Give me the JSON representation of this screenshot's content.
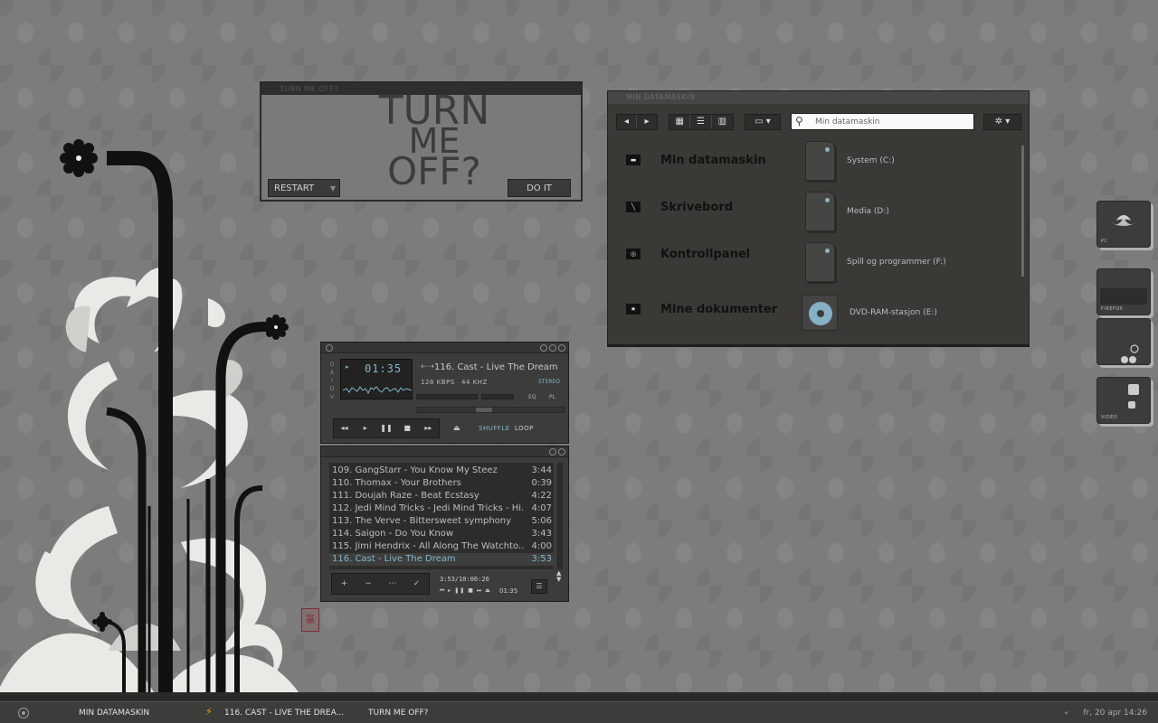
{
  "turnoff": {
    "titlebar": "TURN ME OFF?",
    "title_line1": "TURN",
    "title_line2": "ME",
    "title_line3": "OFF?",
    "restart_label": "RESTART",
    "doit_label": "DO IT"
  },
  "explorer": {
    "titlebar": "MIN DATAMASKIN",
    "search_value": "Min datamaskin",
    "nav_items": [
      {
        "label": "Min datamaskin",
        "icon": "computer-icon"
      },
      {
        "label": "Skrivebord",
        "icon": "desktop-icon"
      },
      {
        "label": "Kontrollpanel",
        "icon": "control-panel-icon"
      },
      {
        "label": "Mine dokumenter",
        "icon": "documents-icon"
      }
    ],
    "drives": [
      {
        "label": "System (C:)",
        "icon": "hard-drive-icon"
      },
      {
        "label": "Media (D:)",
        "icon": "hard-drive-icon"
      },
      {
        "label": "Spill og programmer (F:)",
        "icon": "hard-drive-icon"
      },
      {
        "label": "DVD-RAM-stasjon (E:)",
        "icon": "dvd-drive-icon"
      }
    ]
  },
  "winamp": {
    "clutterbar": [
      "O",
      "A",
      "I",
      "D",
      "V"
    ],
    "time": "01:35",
    "song_title": "116. Cast - Live The Dream (3",
    "kbps": "128",
    "kbps_unit": "KBPS",
    "khz": "44",
    "khz_unit": "KHZ",
    "stereo": "STEREO",
    "eq_label": "EQ",
    "pl_label": "PL",
    "shuffle_label": "SHUFFLE",
    "loop_label": "LOOP",
    "seek_fraction": 0.45,
    "accent": "#7fb7cf"
  },
  "playlist": {
    "items": [
      {
        "title": "109. GangStarr - You Know My Steez",
        "time": "3:44"
      },
      {
        "title": "110. Thomax - Your Brothers",
        "time": "0:39"
      },
      {
        "title": "111. Doujah Raze - Beat Ecstasy",
        "time": "4:22"
      },
      {
        "title": "112. Jedi Mind Tricks - Jedi Mind Tricks - Hi...",
        "time": "4:07"
      },
      {
        "title": "113. The Verve - Bittersweet symphony",
        "time": "5:06"
      },
      {
        "title": "114. Saigon - Do You Know",
        "time": "3:43"
      },
      {
        "title": "115. Jimi Hendrix - All Along The Watchto...",
        "time": "4:00"
      },
      {
        "title": "116. Cast - Live The Dream",
        "time": "3:53"
      }
    ],
    "active_index": 7,
    "time_info": "3:53/10:00:26",
    "mini_time": "01:35",
    "controls": [
      "+",
      "−",
      "⋯",
      "✓"
    ]
  },
  "dock": [
    {
      "label": "PC",
      "icon": "pc-icon"
    },
    {
      "label": "FIREFOX",
      "icon": "firefox-icon"
    },
    {
      "label": "",
      "icon": "music-icon"
    },
    {
      "label": "VIDEO",
      "icon": "video-icon"
    }
  ],
  "taskbar": {
    "tasks": [
      "MIN DATAMASKIN",
      "116. CAST - LIVE THE DREA...",
      "TURN ME OFF?"
    ],
    "clock": "fr, 20 apr 14:26"
  }
}
